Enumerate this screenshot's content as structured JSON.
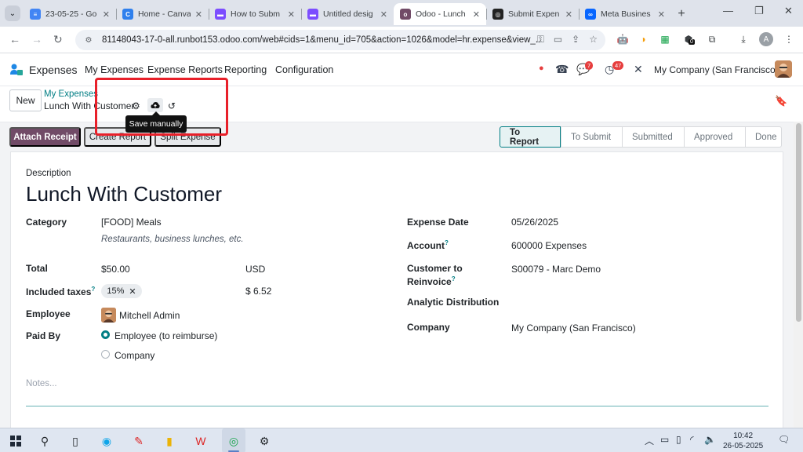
{
  "browser": {
    "tabs": [
      {
        "label": "23-05-25 - Go",
        "color": "#4285f4",
        "glyph": "≡"
      },
      {
        "label": "Home - Canva",
        "color": "#2f80ed",
        "glyph": "C"
      },
      {
        "label": "How to Subm",
        "color": "#7c4dff",
        "glyph": "▬"
      },
      {
        "label": "Untitled desig",
        "color": "#7c4dff",
        "glyph": "▬"
      },
      {
        "label": "Odoo - Lunch",
        "color": "#714b67",
        "glyph": "o"
      },
      {
        "label": "Submit Expen",
        "color": "#222222",
        "glyph": "◎"
      },
      {
        "label": "Meta Busines",
        "color": "#0866ff",
        "glyph": "∞"
      }
    ],
    "url": "81148043-17-0-all.runbot153.odoo.com/web#cids=1&menu_id=705&action=1026&model=hr.expense&view_...",
    "profile_initial": "A",
    "ext_badge": "0"
  },
  "odoo_nav": {
    "app_name": "Expenses",
    "menus": [
      "My Expenses",
      "Expense Reports",
      "Reporting",
      "Configuration"
    ],
    "messages_badge": "7",
    "activities_badge": "47",
    "company": "My Company (San Francisco)"
  },
  "control_panel": {
    "new_label": "New",
    "breadcrumb_parent": "My Expenses",
    "breadcrumb_current": "Lunch With Customer",
    "tooltip": "Save manually"
  },
  "statusbar": {
    "attach_receipt": "Attach Receipt",
    "create_report": "Create Report",
    "split_expense": "Split Expense",
    "stages": [
      "To Report",
      "To Submit",
      "Submitted",
      "Approved",
      "Done"
    ],
    "active_stage": "To Report"
  },
  "form": {
    "description_label": "Description",
    "title": "Lunch With Customer",
    "category_label": "Category",
    "category_value": "[FOOD] Meals",
    "category_desc": "Restaurants, business lunches, etc.",
    "total_label": "Total",
    "total_value": "$50.00",
    "currency": "USD",
    "taxes_label": "Included taxes",
    "tax_tag": "15%",
    "tax_amount": "$ 6.52",
    "employee_label": "Employee",
    "employee_value": "Mitchell Admin",
    "paid_by_label": "Paid By",
    "paid_by_options": [
      "Employee (to reimburse)",
      "Company"
    ],
    "expense_date_label": "Expense Date",
    "expense_date_value": "05/26/2025",
    "account_label": "Account",
    "account_value": "600000 Expenses",
    "customer_label_1": "Customer to",
    "customer_label_2": "Reinvoice",
    "customer_value": "S00079 - Marc Demo",
    "analytic_label": "Analytic Distribution",
    "company_label": "Company",
    "company_value": "My Company (San Francisco)",
    "notes_placeholder": "Notes..."
  },
  "taskbar": {
    "time": "10:42",
    "date": "26-05-2025"
  }
}
